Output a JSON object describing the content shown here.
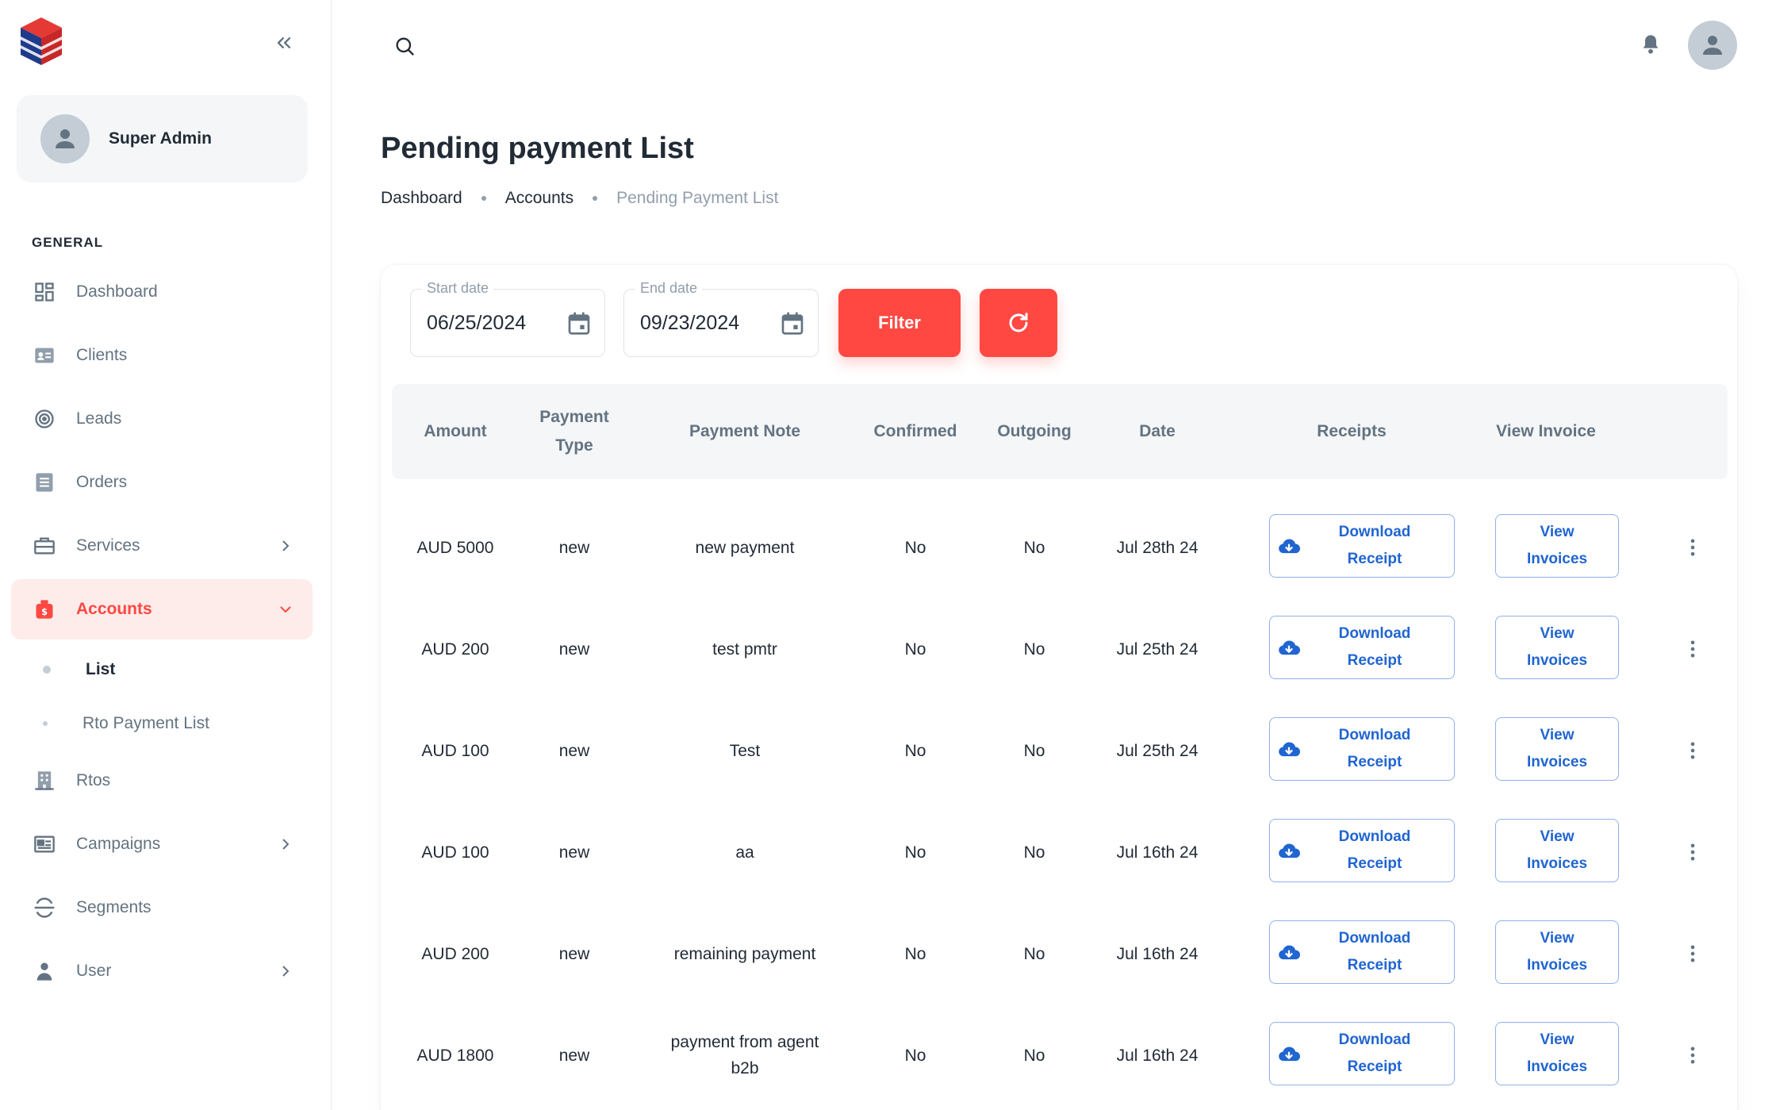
{
  "sidebar": {
    "user_name": "Super Admin",
    "section_label": "GENERAL",
    "items": [
      {
        "label": "Dashboard",
        "icon": "dashboard-icon"
      },
      {
        "label": "Clients",
        "icon": "id-card-icon"
      },
      {
        "label": "Leads",
        "icon": "target-icon"
      },
      {
        "label": "Orders",
        "icon": "list-icon"
      },
      {
        "label": "Services",
        "icon": "briefcase-icon"
      },
      {
        "label": "Accounts",
        "icon": "money-bag-icon"
      },
      {
        "label": "Rtos",
        "icon": "building-icon"
      },
      {
        "label": "Campaigns",
        "icon": "newspaper-icon"
      },
      {
        "label": "Segments",
        "icon": "segments-icon"
      },
      {
        "label": "User",
        "icon": "user-icon"
      }
    ],
    "sub_items": [
      {
        "label": "List"
      },
      {
        "label": "Rto Payment List"
      }
    ]
  },
  "page": {
    "title": "Pending payment List",
    "breadcrumb": [
      "Dashboard",
      "Accounts",
      "Pending Payment List"
    ]
  },
  "filters": {
    "start_label": "Start date",
    "start_value": "06/25/2024",
    "end_label": "End date",
    "end_value": "09/23/2024",
    "filter_label": "Filter"
  },
  "table": {
    "columns": [
      "Amount",
      "Payment Type",
      "Payment Note",
      "Confirmed",
      "Outgoing",
      "Date",
      "Receipts",
      "View Invoice"
    ],
    "receipt_button": "Download Receipt",
    "invoice_button": "View Invoices",
    "rows": [
      {
        "amount": "AUD 5000",
        "type": "new",
        "note": "new payment",
        "confirmed": "No",
        "outgoing": "No",
        "date": "Jul 28th 24"
      },
      {
        "amount": "AUD 200",
        "type": "new",
        "note": "test pmtr",
        "confirmed": "No",
        "outgoing": "No",
        "date": "Jul 25th 24"
      },
      {
        "amount": "AUD 100",
        "type": "new",
        "note": "Test",
        "confirmed": "No",
        "outgoing": "No",
        "date": "Jul 25th 24"
      },
      {
        "amount": "AUD 100",
        "type": "new",
        "note": "aa",
        "confirmed": "No",
        "outgoing": "No",
        "date": "Jul 16th 24"
      },
      {
        "amount": "AUD 200",
        "type": "new",
        "note": "remaining payment",
        "confirmed": "No",
        "outgoing": "No",
        "date": "Jul 16th 24"
      },
      {
        "amount": "AUD 1800",
        "type": "new",
        "note": "payment from agent b2b",
        "confirmed": "No",
        "outgoing": "No",
        "date": "Jul 16th 24"
      }
    ]
  },
  "colors": {
    "accent": "#ff4842",
    "accent_bg": "#fdecea",
    "link": "#2065d1",
    "text": "#212b36",
    "muted": "#637381"
  }
}
